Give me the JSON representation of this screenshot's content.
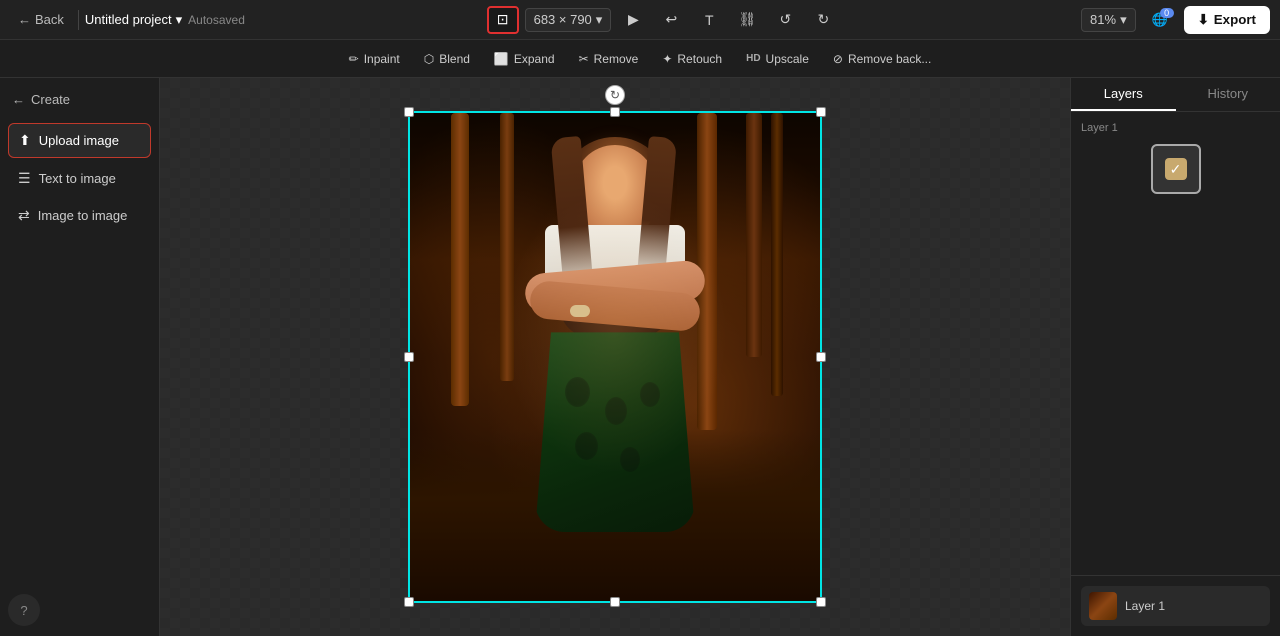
{
  "topbar": {
    "back_label": "Back",
    "project_name": "Untitled project",
    "autosaved": "Autosaved",
    "image_size": "683 × 790",
    "zoom_level": "81%",
    "notifications_count": "0",
    "export_label": "Export",
    "tools": [
      {
        "id": "crop",
        "icon": "⊡",
        "label": "Crop/Resize",
        "active": true
      },
      {
        "id": "play",
        "icon": "▶",
        "label": "Play"
      },
      {
        "id": "undo",
        "icon": "↩",
        "label": "Undo"
      },
      {
        "id": "text",
        "icon": "T",
        "label": "Text"
      },
      {
        "id": "link",
        "icon": "⛓",
        "label": "Link"
      },
      {
        "id": "undo2",
        "icon": "↺",
        "label": "Undo2"
      },
      {
        "id": "redo",
        "icon": "↻",
        "label": "Redo"
      }
    ]
  },
  "secondary_toolbar": {
    "tools": [
      {
        "id": "inpaint",
        "icon": "✏",
        "label": "Inpaint"
      },
      {
        "id": "blend",
        "icon": "⬡",
        "label": "Blend"
      },
      {
        "id": "expand",
        "icon": "⬜",
        "label": "Expand"
      },
      {
        "id": "remove",
        "icon": "✂",
        "label": "Remove"
      },
      {
        "id": "retouch",
        "icon": "✦",
        "label": "Retouch"
      },
      {
        "id": "upscale",
        "icon": "↑",
        "label": "HD Upscale"
      },
      {
        "id": "remove_bg",
        "icon": "⊘",
        "label": "Remove back..."
      }
    ]
  },
  "left_panel": {
    "create_label": "Create",
    "menu_items": [
      {
        "id": "upload_image",
        "icon": "⬆",
        "label": "Upload image",
        "active": true
      },
      {
        "id": "text_to_image",
        "icon": "☰",
        "label": "Text to image"
      },
      {
        "id": "image_to_image",
        "icon": "⇄",
        "label": "Image to image"
      }
    ],
    "help_icon": "?"
  },
  "right_panel": {
    "tabs": [
      {
        "id": "layers",
        "label": "Layers",
        "active": true
      },
      {
        "id": "history",
        "label": "History",
        "active": false
      }
    ],
    "layer_name": "Layer 1",
    "layer_thumb_check": "✓",
    "layer_item_name": "Layer 1"
  },
  "canvas": {
    "selection_rotate_icon": "↻"
  }
}
